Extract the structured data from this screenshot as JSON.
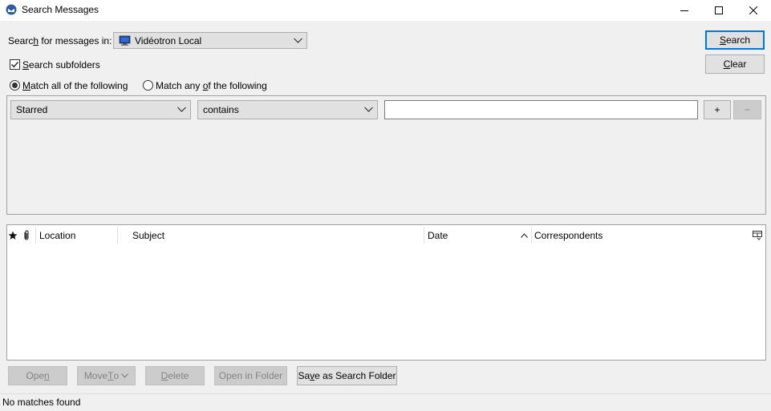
{
  "window": {
    "title": "Search Messages"
  },
  "search": {
    "location_label_pre": "Searc",
    "location_label_key": "h",
    "location_label_post": " for messages in:",
    "location_value": "Vidéotron Local",
    "subfolders_label_key": "S",
    "subfolders_label_post": "earch subfolders",
    "subfolders_checked": true,
    "match_all_label_key": "M",
    "match_all_label_post": "atch all of the following",
    "match_any_label_pre": "Match any ",
    "match_any_label_key": "o",
    "match_any_label_post": "f the following",
    "match_mode": "all"
  },
  "buttons": {
    "search_key": "S",
    "search_post": "earch",
    "clear_key": "C",
    "clear_post": "lear",
    "add": "+",
    "remove": "−"
  },
  "rule": {
    "field": "Starred",
    "operator": "contains",
    "value": ""
  },
  "results": {
    "columns": {
      "location": "Location",
      "subject": "Subject",
      "date": "Date",
      "correspondents": "Correspondents"
    },
    "sort_column": "Date",
    "rows": []
  },
  "actions": {
    "open_pre": "Ope",
    "open_key": "n",
    "move_to_pre": "Move ",
    "move_to_key": "T",
    "move_to_post": "o",
    "delete_key": "D",
    "delete_post": "elete",
    "open_in_folder": "Open in Folder",
    "save_pre": "Sa",
    "save_key": "v",
    "save_post": "e as Search Folder"
  },
  "status": {
    "text": "No matches found"
  },
  "colors": {
    "accent": "#0078d7",
    "window_bg": "#f0f0f0"
  }
}
